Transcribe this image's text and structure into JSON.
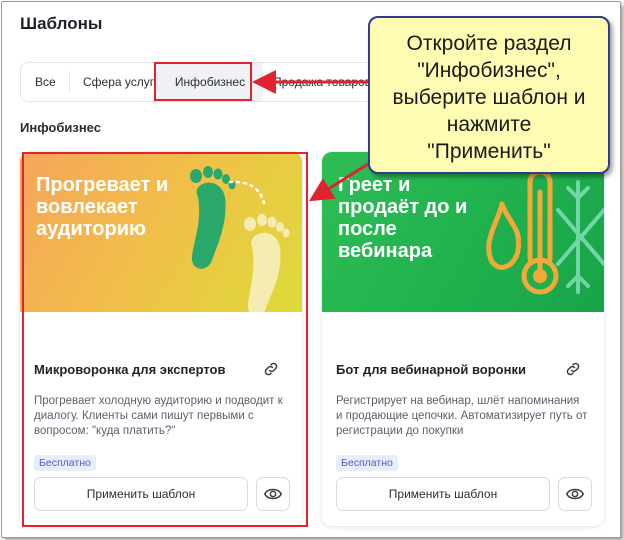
{
  "page": {
    "title": "Шаблоны",
    "section_title": "Инфобизнес"
  },
  "tabs": [
    {
      "label": "Все",
      "active": false
    },
    {
      "label": "Сфера услуг",
      "active": false
    },
    {
      "label": "Инфобизнес",
      "active": true
    },
    {
      "label": "Продажа товаров",
      "active": false
    }
  ],
  "cards": [
    {
      "image_text": "Прогревает и вовлекает аудиторию",
      "title": "Микроворонка для экспертов",
      "description": "Прогревает холодную аудиторию и подводит к диалогу. Клиенты сами пишут первыми с вопросом: \"куда платить?\"",
      "badge": "Бесплатно",
      "apply_label": "Применить шаблон",
      "image_icon": "footprints-icon"
    },
    {
      "image_text": "Греет и продаёт до и после вебинара",
      "title": "Бот для вебинарной воронки",
      "description": "Регистрирует на вебинар, шлёт напоминания и продающие цепочки. Автоматизирует путь от регистрации до покупки",
      "badge": "Бесплатно",
      "apply_label": "Применить шаблон",
      "image_icon": "fire-thermometer-snowflake-icon"
    }
  ],
  "callout": {
    "lines": [
      "Откройте раздел",
      "\"Инфобизнес\",",
      "выберите шаблон и",
      "нажмите",
      "\"Применить\""
    ]
  },
  "colors": {
    "annotation_red": "#e0232e",
    "callout_bg": "#fefbb3",
    "callout_border": "#2e3d86",
    "badge_text": "#4a5fc1"
  }
}
